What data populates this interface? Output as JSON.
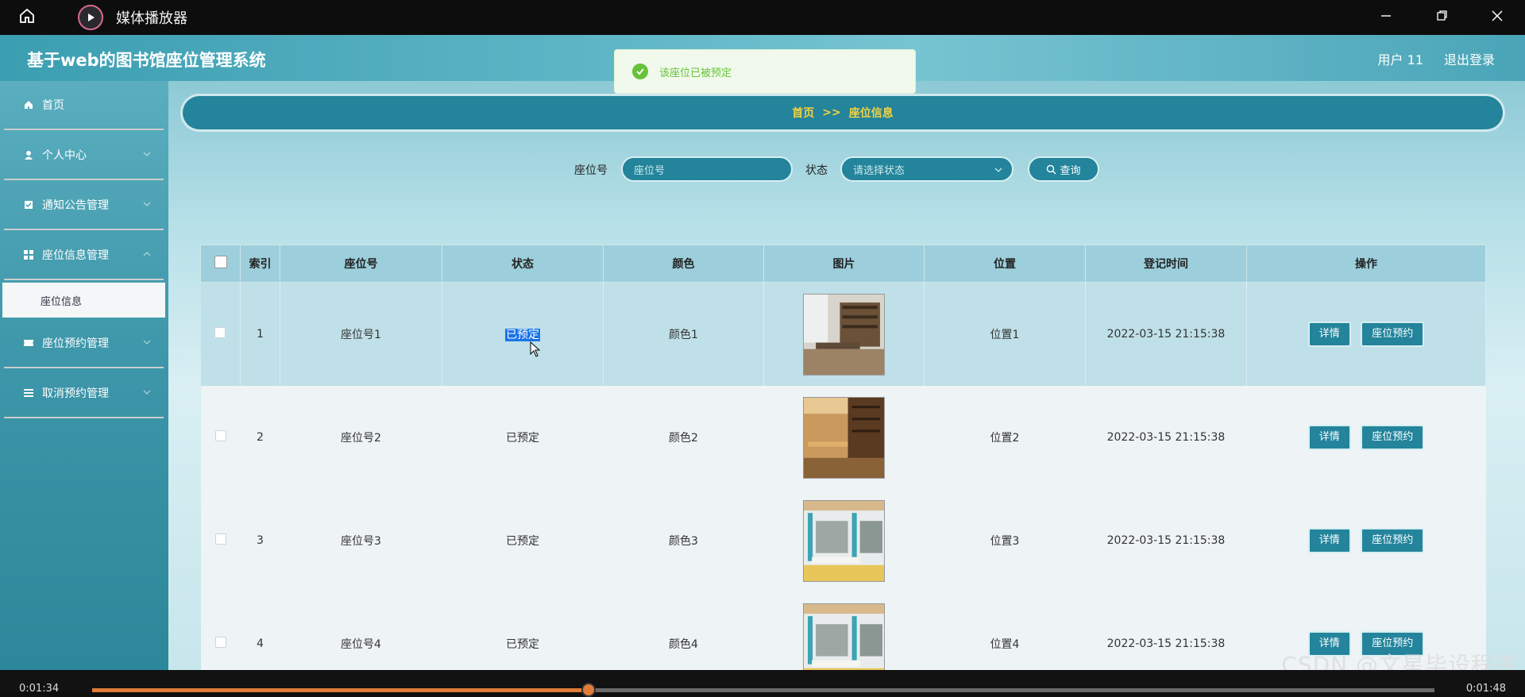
{
  "player": {
    "title": "媒体播放器",
    "time_current": "0:01:34",
    "time_total": "0:01:48",
    "progress_percent": 37
  },
  "app": {
    "title": "基于web的图书馆座位管理系统",
    "user": "用户 11",
    "logout": "退出登录"
  },
  "toast": {
    "message": "该座位已被预定"
  },
  "sidebar": {
    "items": [
      {
        "label": "首页",
        "icon": "home-icon"
      },
      {
        "label": "个人中心",
        "icon": "user-icon"
      },
      {
        "label": "通知公告管理",
        "icon": "notice-icon"
      },
      {
        "label": "座位信息管理",
        "icon": "grid-icon"
      },
      {
        "label": "座位预约管理",
        "icon": "reserve-icon"
      },
      {
        "label": "取消预约管理",
        "icon": "list-icon"
      }
    ],
    "sub_active": "座位信息"
  },
  "breadcrumb": {
    "home": "首页",
    "sep": ">>",
    "current": "座位信息"
  },
  "search": {
    "seat_label": "座位号",
    "seat_placeholder": "座位号",
    "status_label": "状态",
    "status_placeholder": "请选择状态",
    "query_button": "查询"
  },
  "table": {
    "headers": [
      "索引",
      "座位号",
      "状态",
      "颜色",
      "图片",
      "位置",
      "登记时间",
      "操作"
    ],
    "rows": [
      {
        "index": "1",
        "seat": "座位号1",
        "status": "已预定",
        "color": "颜色1",
        "location": "位置1",
        "time": "2022-03-15 21:15:38"
      },
      {
        "index": "2",
        "seat": "座位号2",
        "status": "已预定",
        "color": "颜色2",
        "location": "位置2",
        "time": "2022-03-15 21:15:38"
      },
      {
        "index": "3",
        "seat": "座位号3",
        "status": "已预定",
        "color": "颜色3",
        "location": "位置3",
        "time": "2022-03-15 21:15:38"
      },
      {
        "index": "4",
        "seat": "座位号4",
        "status": "已预定",
        "color": "颜色4",
        "location": "位置4",
        "time": "2022-03-15 21:15:38"
      }
    ],
    "action_detail": "详情",
    "action_reserve": "座位预约"
  },
  "watermark": "CSDN @文星毕设程序",
  "colors": {
    "primary": "#23849b",
    "accent_yellow": "#f7d23c",
    "toast_green": "#67c23a",
    "progress": "#e07b39"
  }
}
